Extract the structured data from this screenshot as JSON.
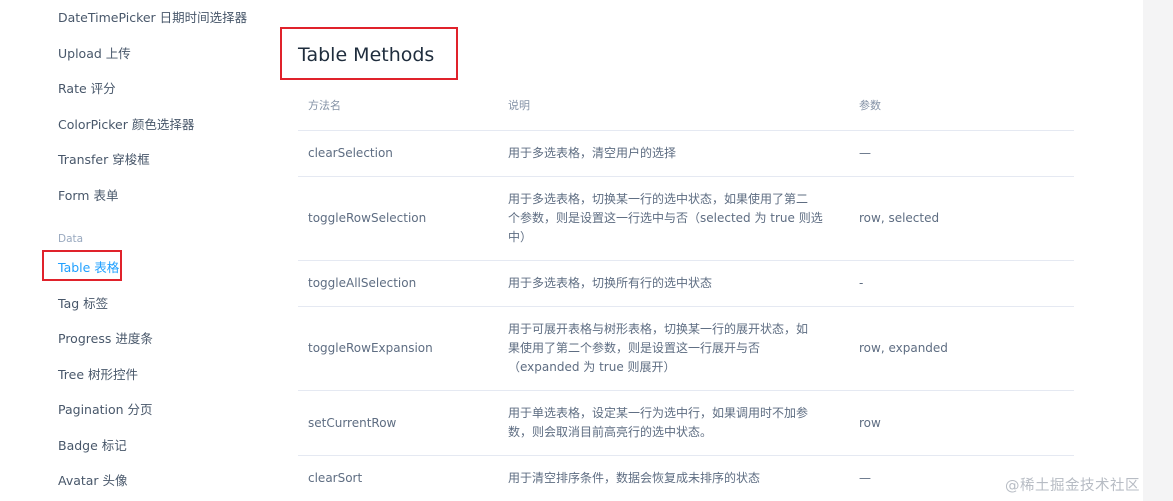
{
  "sidebar": {
    "items": [
      {
        "label": "DateTimePicker 日期时间选择器"
      },
      {
        "label": "Upload 上传"
      },
      {
        "label": "Rate 评分"
      },
      {
        "label": "ColorPicker 颜色选择器"
      },
      {
        "label": "Transfer 穿梭框"
      },
      {
        "label": "Form 表单"
      }
    ],
    "group_label": "Data",
    "data_items": [
      {
        "label": "Table 表格",
        "active": true
      },
      {
        "label": "Tag 标签"
      },
      {
        "label": "Progress 进度条"
      },
      {
        "label": "Tree 树形控件"
      },
      {
        "label": "Pagination 分页"
      },
      {
        "label": "Badge 标记"
      },
      {
        "label": "Avatar 头像"
      }
    ]
  },
  "main": {
    "title": "Table Methods",
    "table": {
      "headers": [
        "方法名",
        "说明",
        "参数"
      ],
      "rows": [
        {
          "name": "clearSelection",
          "desc": "用于多选表格，清空用户的选择",
          "params": "—"
        },
        {
          "name": "toggleRowSelection",
          "desc_lines": [
            "用于多选表格，切换某一行的选中状态，如果使用了第二",
            "个参数，则是设置这一行选中与否（selected 为 true 则选",
            "中）"
          ],
          "params": "row, selected"
        },
        {
          "name": "toggleAllSelection",
          "desc": "用于多选表格，切换所有行的选中状态",
          "params": "-"
        },
        {
          "name": "toggleRowExpansion",
          "desc_lines": [
            "用于可展开表格与树形表格，切换某一行的展开状态，如",
            "果使用了第二个参数，则是设置这一行展开与否",
            "（expanded 为 true 则展开）"
          ],
          "params": "row, expanded"
        },
        {
          "name": "setCurrentRow",
          "desc_lines": [
            "用于单选表格，设定某一行为选中行，如果调用时不加参",
            "数，则会取消目前高亮行的选中状态。"
          ],
          "params": "row"
        },
        {
          "name": "clearSort",
          "desc": "用于清空排序条件，数据会恢复成未排序的状态",
          "params": "—"
        }
      ]
    }
  },
  "watermark": "@稀土掘金技术社区",
  "colors": {
    "accent": "#20a0ff",
    "highlight_box": "#e0222b"
  }
}
